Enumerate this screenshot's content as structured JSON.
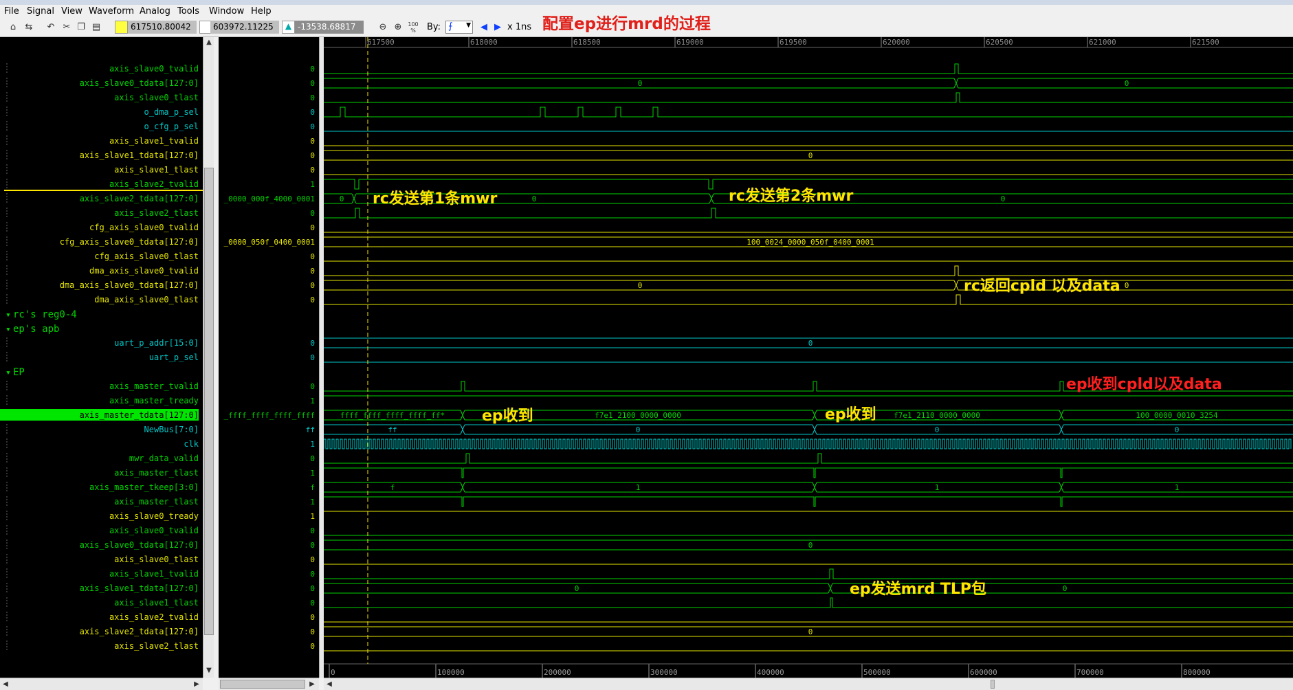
{
  "menu": [
    "File",
    "Signal",
    "View",
    "Waveform",
    "Analog",
    "Tools",
    "Window",
    "Help"
  ],
  "toolbar": {
    "cursor_time": "617510.80042",
    "marker_time": "603972.11225",
    "delta_time": "-13538.68817",
    "by_label": "By:",
    "unit": "x 1ns",
    "zoom_label": "100 %"
  },
  "title_note": "配置ep进行mrd的过程",
  "colors": {
    "green": "#00d400",
    "cyan": "#00c8c8",
    "yellow": "#e6e600",
    "red": "#ff2020",
    "bg": "#000000",
    "selected": "#00e600"
  },
  "time_ruler": {
    "start": 617300,
    "ticks": [
      "617500",
      "618000",
      "618500",
      "619000",
      "619500",
      "620000",
      "620500",
      "621000",
      "621500"
    ]
  },
  "overview_ruler": [
    "0",
    "100000",
    "200000",
    "300000",
    "400000",
    "500000",
    "600000",
    "700000",
    "800000"
  ],
  "groups": [
    "rc's reg0-4",
    "ep's apb",
    "EP"
  ],
  "signals": [
    {
      "name": "axis_slave0_tvalid",
      "val": "0",
      "color": "green"
    },
    {
      "name": "axis_slave0_tdata[127:0]",
      "val": "0",
      "color": "green"
    },
    {
      "name": "axis_slave0_tlast",
      "val": "0",
      "color": "green"
    },
    {
      "name": "o_dma_p_sel",
      "val": "0",
      "color": "cyan"
    },
    {
      "name": "o_cfg_p_sel",
      "val": "0",
      "color": "cyan"
    },
    {
      "name": "axis_slave1_tvalid",
      "val": "0",
      "color": "yellow"
    },
    {
      "name": "axis_slave1_tdata[127:0]",
      "val": "0",
      "color": "yellow"
    },
    {
      "name": "axis_slave1_tlast",
      "val": "0",
      "color": "yellow"
    },
    {
      "name": "axis_slave2_tvalid",
      "val": "1",
      "color": "green"
    },
    {
      "name": "axis_slave2_tdata[127:0]",
      "val": "_0000_000f_4000_0001",
      "color": "green"
    },
    {
      "name": "axis_slave2_tlast",
      "val": "0",
      "color": "green"
    },
    {
      "name": "cfg_axis_slave0_tvalid",
      "val": "0",
      "color": "yellow"
    },
    {
      "name": "cfg_axis_slave0_tdata[127:0]",
      "val": "_0000_050f_0400_0001",
      "color": "yellow"
    },
    {
      "name": "cfg_axis_slave0_tlast",
      "val": "0",
      "color": "yellow"
    },
    {
      "name": "dma_axis_slave0_tvalid",
      "val": "0",
      "color": "yellow"
    },
    {
      "name": "dma_axis_slave0_tdata[127:0]",
      "val": "0",
      "color": "yellow"
    },
    {
      "name": "dma_axis_slave0_tlast",
      "val": "0",
      "color": "yellow"
    },
    {
      "group": 0
    },
    {
      "group": 1
    },
    {
      "name": "uart_p_addr[15:0]",
      "val": "0",
      "color": "cyan"
    },
    {
      "name": "uart_p_sel",
      "val": "0",
      "color": "cyan"
    },
    {
      "group": 2
    },
    {
      "name": "axis_master_tvalid",
      "val": "0",
      "color": "green"
    },
    {
      "name": "axis_master_tready",
      "val": "1",
      "color": "green"
    },
    {
      "name": "axis_master_tdata[127:0]",
      "val": "_ffff_ffff_ffff_ffff",
      "color": "green",
      "selected": true
    },
    {
      "name": "NewBus[7:0]",
      "val": "ff",
      "color": "cyan"
    },
    {
      "name": "clk",
      "val": "1",
      "color": "cyan"
    },
    {
      "name": "mwr_data_valid",
      "val": "0",
      "color": "green"
    },
    {
      "name": "axis_master_tlast",
      "val": "1",
      "color": "green"
    },
    {
      "name": "axis_master_tkeep[3:0]",
      "val": "f",
      "color": "green"
    },
    {
      "name": "axis_master_tlast",
      "val": "1",
      "color": "green"
    },
    {
      "name": "axis_slave0_tready",
      "val": "1",
      "color": "yellow"
    },
    {
      "name": "axis_slave0_tvalid",
      "val": "0",
      "color": "green"
    },
    {
      "name": "axis_slave0_tdata[127:0]",
      "val": "0",
      "color": "green"
    },
    {
      "name": "axis_slave0_tlast",
      "val": "0",
      "color": "yellow"
    },
    {
      "name": "axis_slave1_tvalid",
      "val": "0",
      "color": "green"
    },
    {
      "name": "axis_slave1_tdata[127:0]",
      "val": "0",
      "color": "green"
    },
    {
      "name": "axis_slave1_tlast",
      "val": "0",
      "color": "green"
    },
    {
      "name": "axis_slave2_tvalid",
      "val": "0",
      "color": "yellow"
    },
    {
      "name": "axis_slave2_tdata[127:0]",
      "val": "0",
      "color": "yellow"
    },
    {
      "name": "axis_slave2_tlast",
      "val": "0",
      "color": "yellow"
    }
  ],
  "bus_labels": {
    "r1": [
      "0",
      "0"
    ],
    "r6": [
      "0"
    ],
    "r9": [
      "0",
      "0",
      "0"
    ],
    "r12": [
      "100_0024_0000_050f_0400_0001"
    ],
    "r15": [
      "0",
      "0"
    ],
    "r19": [
      "0"
    ],
    "r24": [
      "ffff_ffff_ffff_ffff_ff*",
      "f7e1_2100_0000_0000",
      "f7e1_2110_0000_0000",
      "100_0000_0010_3254"
    ],
    "r25": [
      "ff",
      "0",
      "0",
      "0"
    ],
    "r29": [
      "f",
      "1",
      "1",
      "1"
    ],
    "r33": [
      "0"
    ],
    "r36": [
      "0",
      "0"
    ],
    "r39": [
      "0"
    ]
  },
  "annotations": [
    "rc发送第1条mwr",
    "rc发送第2条mwr",
    "rc返回cpld 以及data",
    "ep收到cpld以及data",
    "ep收到",
    "ep收到",
    "ep发送mrd TLP包"
  ]
}
